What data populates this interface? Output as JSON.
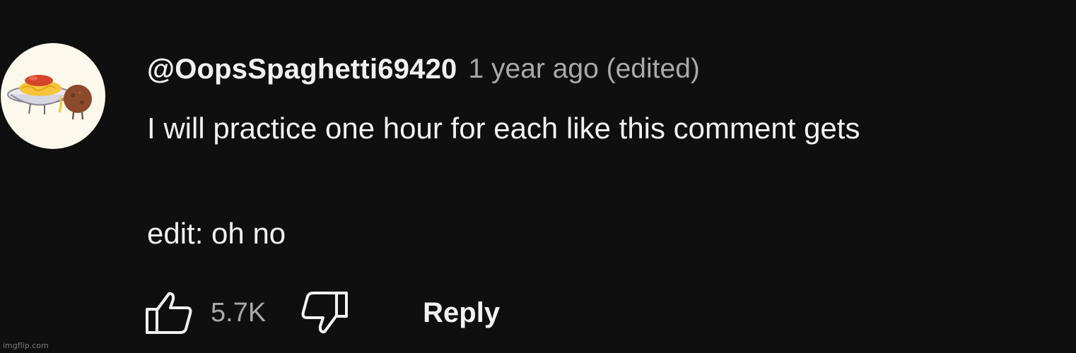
{
  "comment": {
    "author": "@OopsSpaghetti69420",
    "meta": "1 year ago (edited)",
    "body_line1": "I will practice one hour for each like this comment gets",
    "body_line2": "edit: oh no",
    "avatar_icon": "spaghetti-meatball-avatar"
  },
  "actions": {
    "like_icon": "thumbs-up-icon",
    "like_count": "5.7K",
    "dislike_icon": "thumbs-down-icon",
    "reply_label": "Reply"
  },
  "watermark": "imgflip.com",
  "colors": {
    "background": "#0f0f0f",
    "primary_text": "#f1f1f1",
    "secondary_text": "#aaaaaa"
  }
}
